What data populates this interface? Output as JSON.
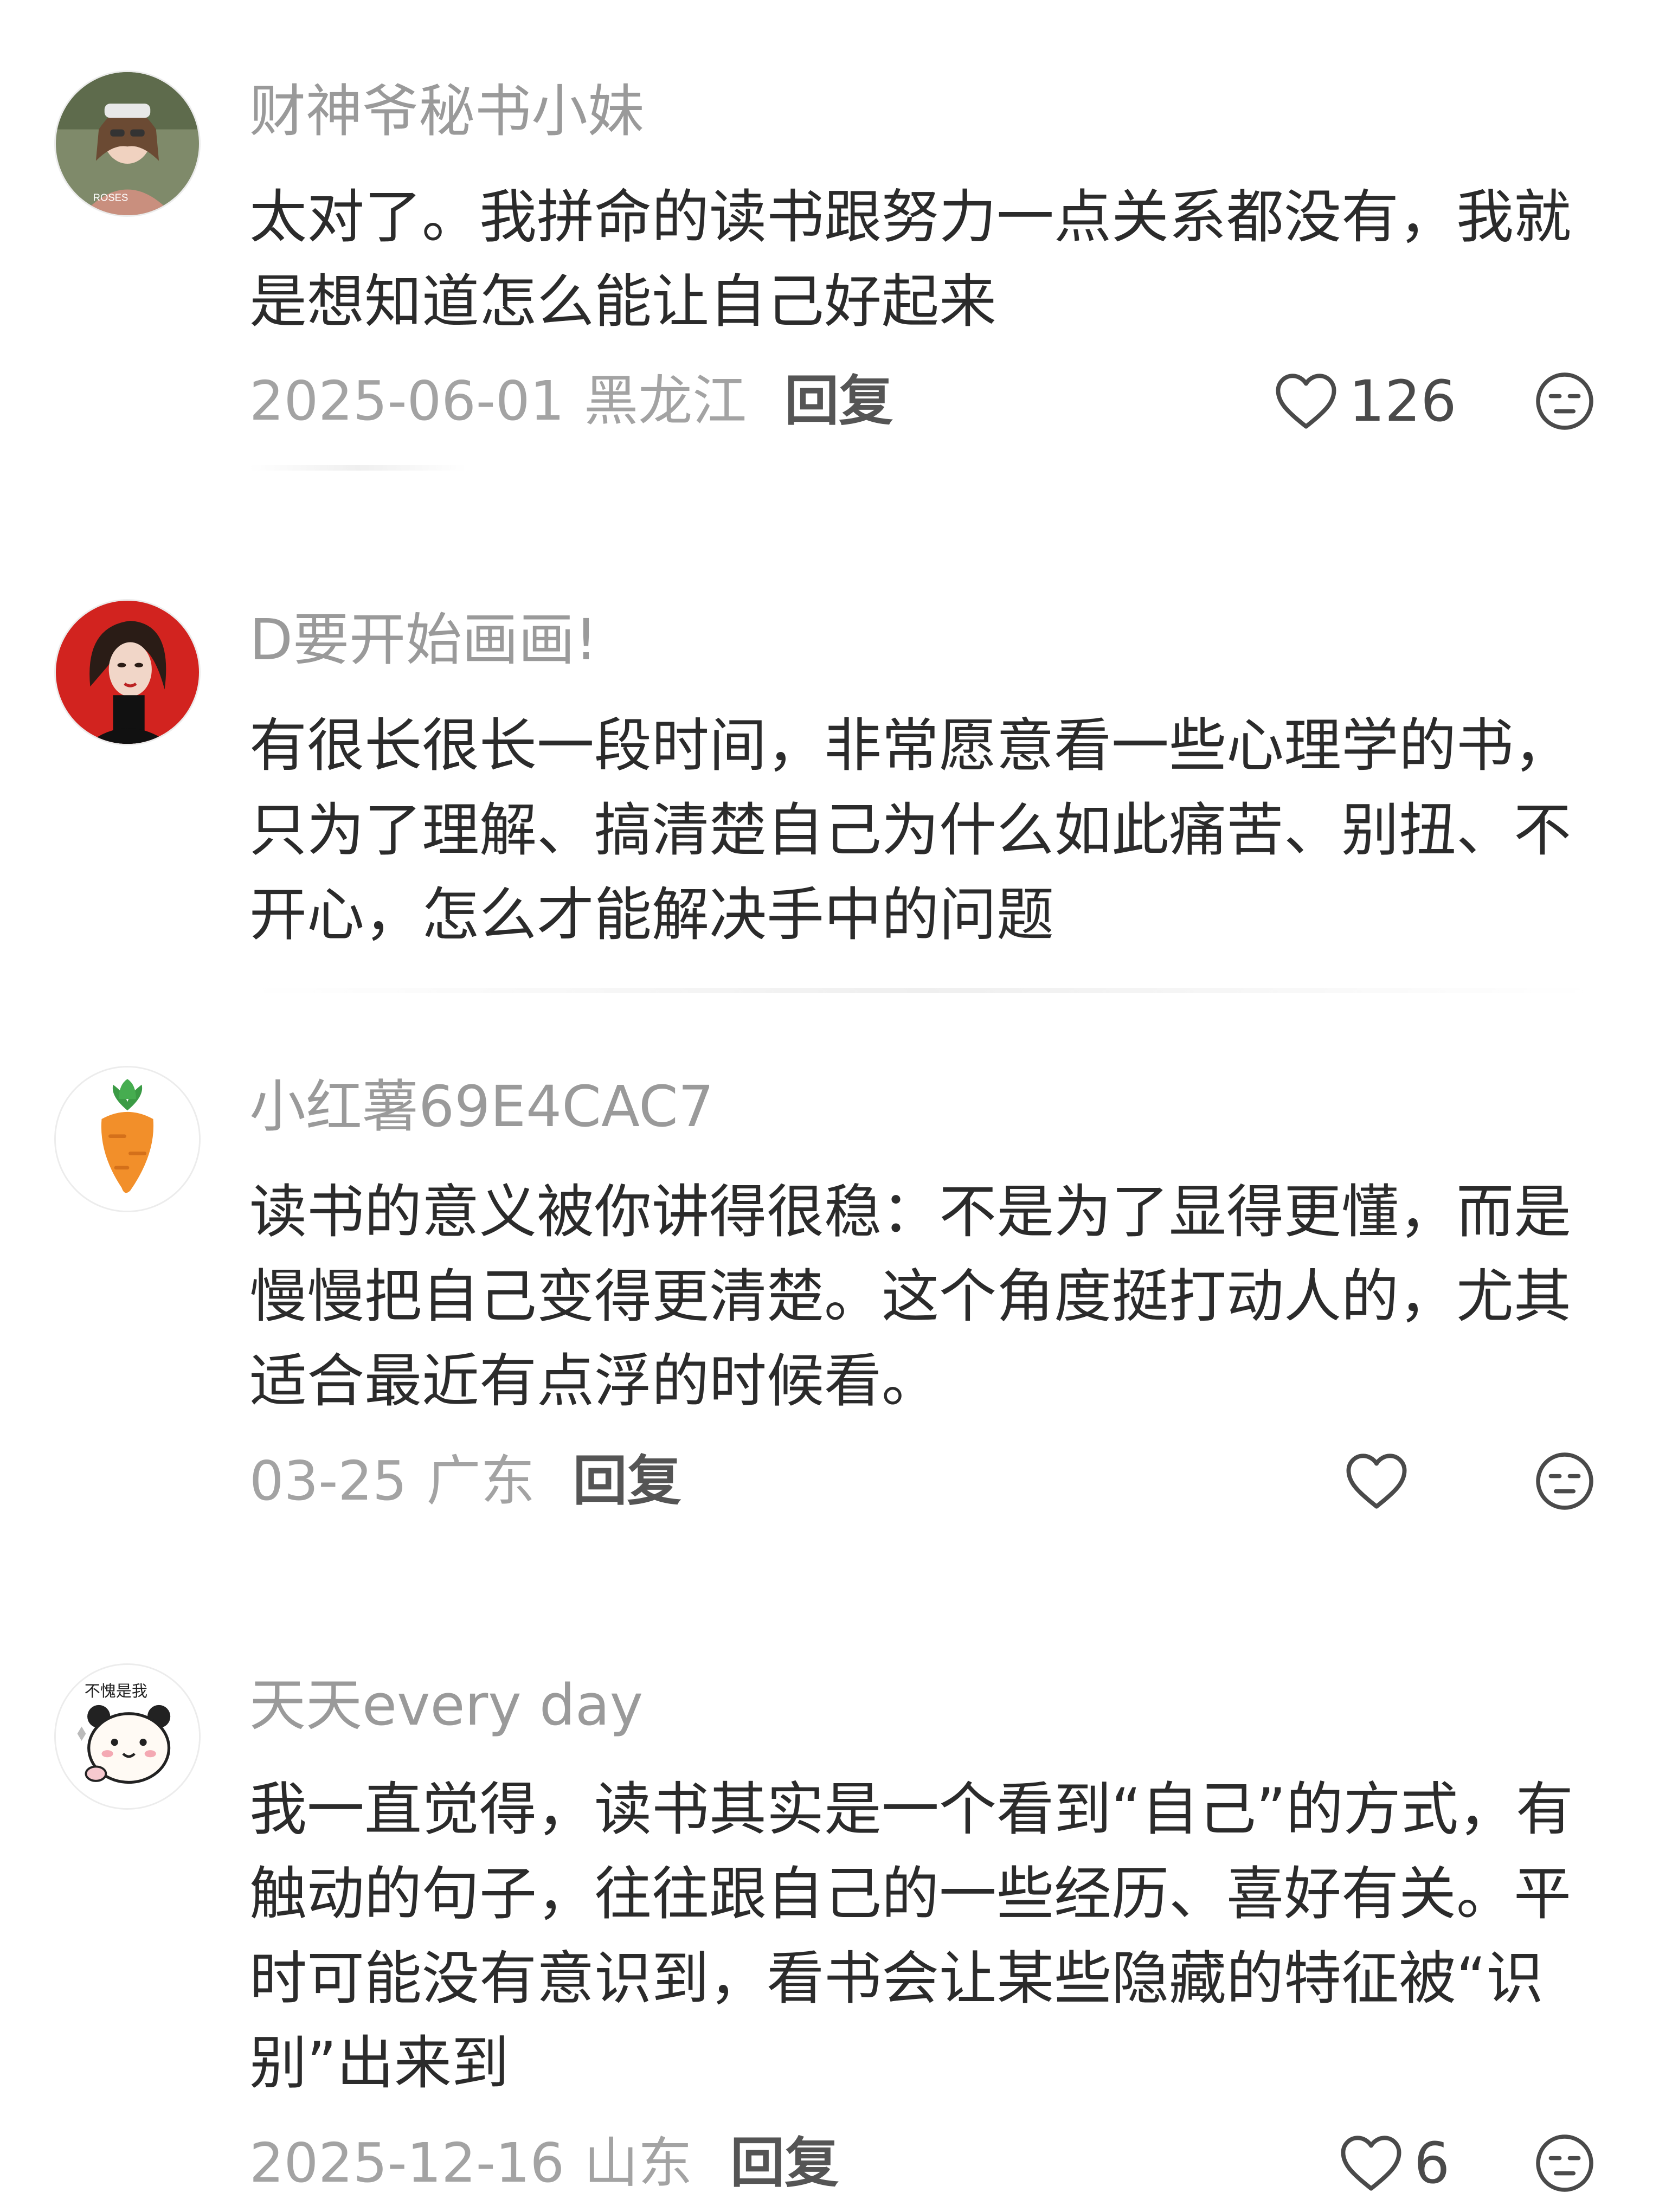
{
  "comments": [
    {
      "username": "财神爷秘书小妹",
      "text": "太对了。我拼命的读书跟努力一点关系都没有，我就是想知道怎么能让自己好起来",
      "date": "2025-06-01",
      "location": "黑龙江",
      "reply_label": "回复",
      "likes": "126"
    },
    {
      "username": "D要开始画画!",
      "text": "有很长很长一段时间，非常愿意看一些心理学的书，只为了理解、搞清楚自己为什么如此痛苦、别扭、不开心，怎么才能解决手中的问题"
    },
    {
      "username": "小红薯69E4CAC7",
      "text": "读书的意义被你讲得很稳：不是为了显得更懂，而是慢慢把自己变得更清楚。这个角度挺打动人的，尤其适合最近有点浮的时候看。",
      "date": "03-25",
      "location": "广东",
      "reply_label": "回复",
      "likes": ""
    },
    {
      "username": "天天every day",
      "text": "我一直觉得，读书其实是一个看到“自己”的方式，有触动的句子，往往跟自己的一些经历、喜好有关。平时可能没有意识到，看书会让某些隐藏的特征被“识别”出来到",
      "date": "2025-12-16",
      "location": "山东",
      "reply_label": "回复",
      "likes": "6"
    }
  ],
  "avatar_badge_text": "不愧是我",
  "icons": {
    "like": "heart-outline-icon",
    "dislike": "unamused-face-icon",
    "carrot_avatar": "carrot-icon"
  },
  "colors": {
    "username": "#9a9a9a",
    "body_text": "#2b2b2b",
    "meta": "#a3a3a3",
    "reply": "#555555",
    "background": "#ffffff"
  }
}
